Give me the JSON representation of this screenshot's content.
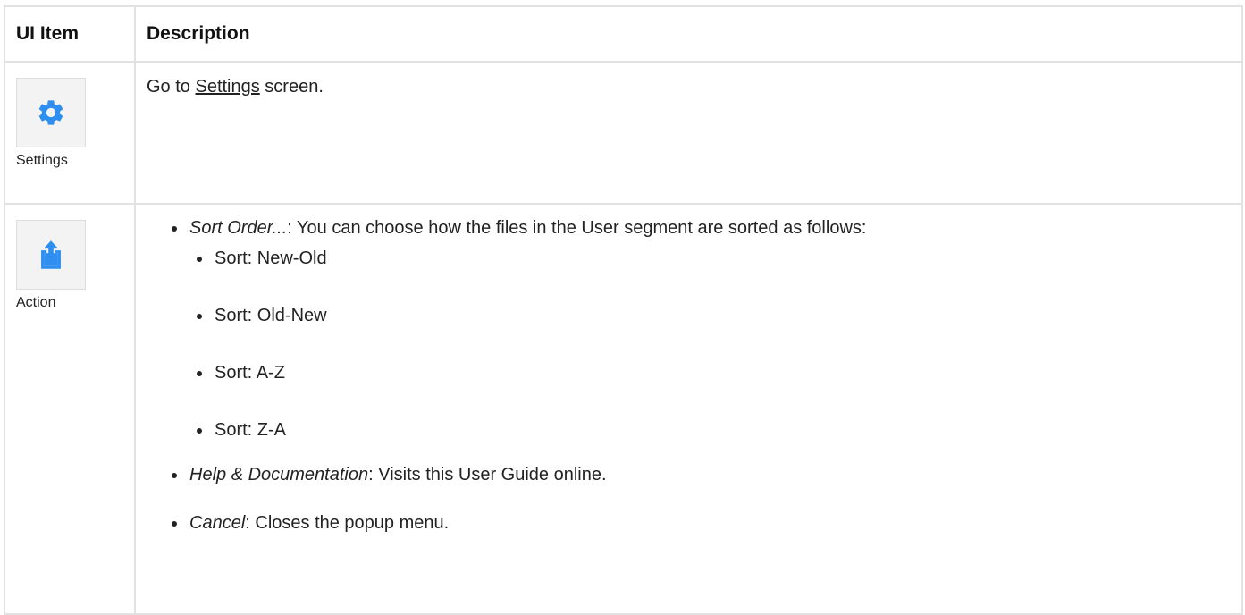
{
  "table": {
    "headers": {
      "item": "UI Item",
      "description": "Description"
    },
    "rows": {
      "settings": {
        "icon": "gear-icon",
        "label": "Settings",
        "desc_prefix": "Go to ",
        "desc_link": "Settings",
        "desc_suffix": " screen."
      },
      "action": {
        "icon": "share-icon",
        "label": "Action",
        "items": [
          {
            "term": "Sort Order...",
            "text": ": You can choose how the files in the User segment are sorted as follows:",
            "sub_items": [
              "Sort: New-Old",
              "Sort: Old-New",
              "Sort: A-Z",
              "Sort: Z-A"
            ]
          },
          {
            "term": "Help & Documentation",
            "text": ": Visits this User Guide online."
          },
          {
            "term": "Cancel",
            "text": ": Closes the popup menu."
          }
        ]
      }
    }
  },
  "colors": {
    "icon_blue": "#2f8ff0",
    "border": "#e2e2e2",
    "icon_bg": "#f3f3f3"
  }
}
